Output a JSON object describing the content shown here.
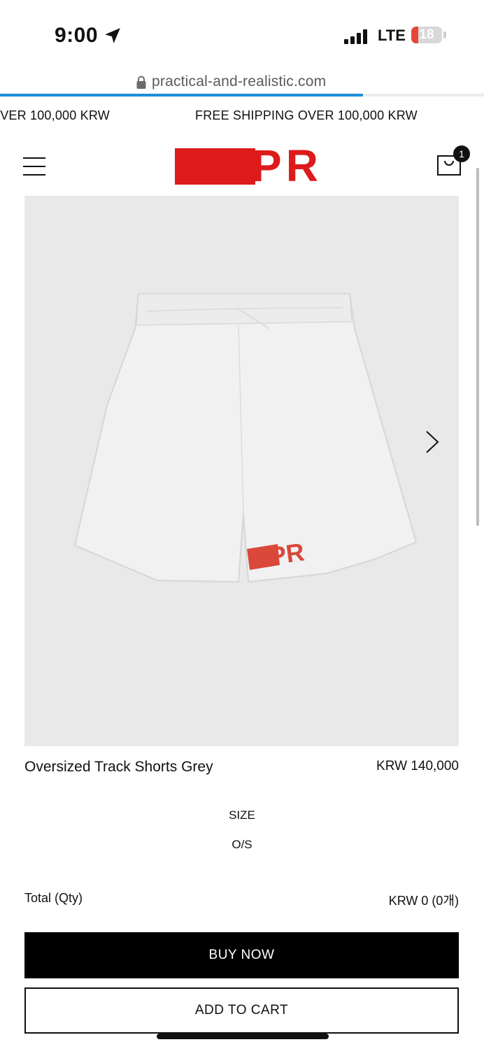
{
  "status_bar": {
    "time": "9:00",
    "network": "LTE",
    "battery": "18",
    "battery_color": "#e5473a",
    "location_icon": "location-arrow-icon",
    "signal_icon": "signal-bars-icon"
  },
  "browser": {
    "url": "practical-and-realistic.com",
    "lock_icon": "lock-icon",
    "load_progress_percent": 75,
    "progress_color": "#1e8fd8"
  },
  "announcement": {
    "text_partial": "OVER 100,000 KRW",
    "text": "FREE SHIPPING OVER 100,000 KRW"
  },
  "header": {
    "logo_text": "PR",
    "brand_color": "#dd1b1b",
    "menu_icon": "hamburger-menu-icon",
    "cart_icon": "shopping-bag-icon",
    "cart_count": "1"
  },
  "product": {
    "name": "Oversized Track Shorts Grey",
    "price": "KRW 140,000",
    "image_logo_text": "PR",
    "next_icon": "chevron-right-icon"
  },
  "options": {
    "size_label": "SIZE",
    "size_value": "O/S"
  },
  "total": {
    "label": "Total (Qty)",
    "value": "KRW 0 (0개)"
  },
  "actions": {
    "buy_now": "BUY NOW",
    "add_to_cart": "ADD TO CART"
  }
}
